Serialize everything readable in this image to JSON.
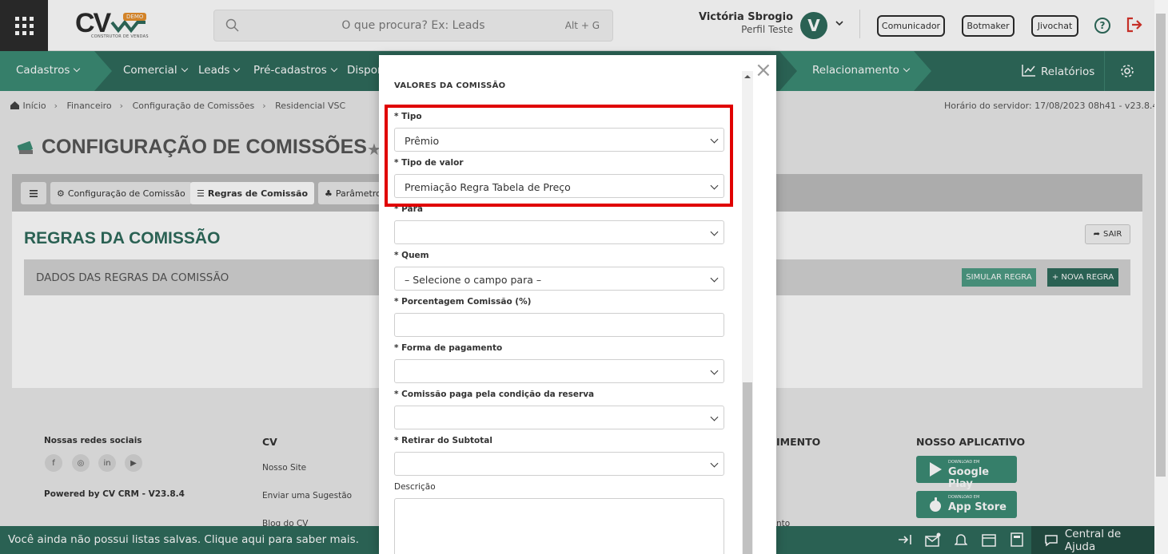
{
  "header": {
    "logo_text": "CV",
    "logo_badge": "DEMO",
    "logo_subtitle": "CONSTRUTOR DE VENDAS",
    "search_placeholder": "O que procura? Ex: Leads",
    "search_shortcut": "Alt + G",
    "user_name": "Victória Sbrogio",
    "user_profile": "Perfil Teste",
    "avatar_letter": "V",
    "buttons": [
      "Comunicador",
      "Botmaker",
      "Jivochat"
    ],
    "help_symbol": "?"
  },
  "nav": {
    "items": [
      "Cadastros",
      "Comercial",
      "Leads",
      "Pré-cadastros",
      "Dispon",
      "Relacionamento"
    ],
    "reports": "Relatórios"
  },
  "breadcrumb": [
    "Início",
    "Financeiro",
    "Configuração de Comissões",
    "Residencial VSC"
  ],
  "server_time": "Horário do servidor: 17/08/2023 08h41 - v23.8.4",
  "page_title": "CONFIGURAÇÃO DE COMISSÕES",
  "tabs": [
    "Configuração de Comissão",
    "Regras de Comissão",
    "Parâmetro"
  ],
  "section_title": "REGRAS DA COMISSÃO",
  "exit_label": "SAIR",
  "dados_label": "DADOS DAS REGRAS DA COMISSÃO",
  "simulate_label": "SIMULAR REGRA",
  "new_rule_label": "+ NOVA REGRA",
  "footer": {
    "social_title": "Nossas redes sociais",
    "powered": "Powered by CV CRM - V23.8.4",
    "cv_title": "CV",
    "cv_links": [
      "Nosso Site",
      "Enviar uma Sugestão",
      "Blog do CV"
    ],
    "atend_partial": "IMENTO",
    "atend_link_partial": "nto",
    "app_title": "NOSSO APLICATIVO",
    "google_small": "DOWNLOAD EM",
    "google_big": "Google Play",
    "apple_small": "DOWNLOAD EM",
    "apple_big": "App Store"
  },
  "bottom_bar": {
    "message": "Você ainda não possui listas salvas. Clique aqui para saber mais.",
    "help": "Central de Ajuda"
  },
  "modal": {
    "section": "VALORES DA COMISSÃO",
    "fields": [
      {
        "label": "* Tipo",
        "value": "Prêmio"
      },
      {
        "label": "* Tipo de valor",
        "value": "Premiação Regra Tabela de Preço"
      },
      {
        "label": "* Para",
        "value": ""
      },
      {
        "label": "* Quem",
        "value": "– Selecione o campo para –"
      },
      {
        "label": "* Porcentagem Comissão (%)",
        "value": ""
      },
      {
        "label": "* Forma de pagamento",
        "value": ""
      },
      {
        "label": "* Comissão paga pela condição da reserva",
        "value": ""
      },
      {
        "label": "* Retirar do Subtotal",
        "value": ""
      },
      {
        "label": "Descrição",
        "value": ""
      }
    ],
    "close_symbol": "×"
  },
  "colors": {
    "brand_green": "#2f6b5c",
    "accent_green": "#3c8c75",
    "highlight": "#e00000"
  }
}
